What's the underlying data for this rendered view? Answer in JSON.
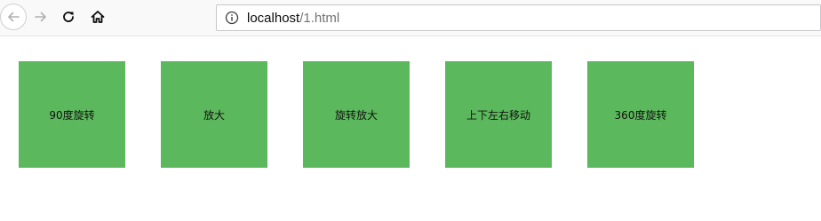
{
  "browser": {
    "url_host": "localhost",
    "url_path": "/1.html",
    "icons": {
      "back": "back-arrow-icon",
      "forward": "forward-arrow-icon",
      "reload": "reload-icon",
      "home": "home-icon",
      "info": "info-icon"
    }
  },
  "page": {
    "box_color": "#5cb85c",
    "boxes": [
      {
        "label": "90度旋转"
      },
      {
        "label": "放大"
      },
      {
        "label": "旋转放大"
      },
      {
        "label": "上下左右移动"
      },
      {
        "label": "360度旋转"
      }
    ]
  }
}
